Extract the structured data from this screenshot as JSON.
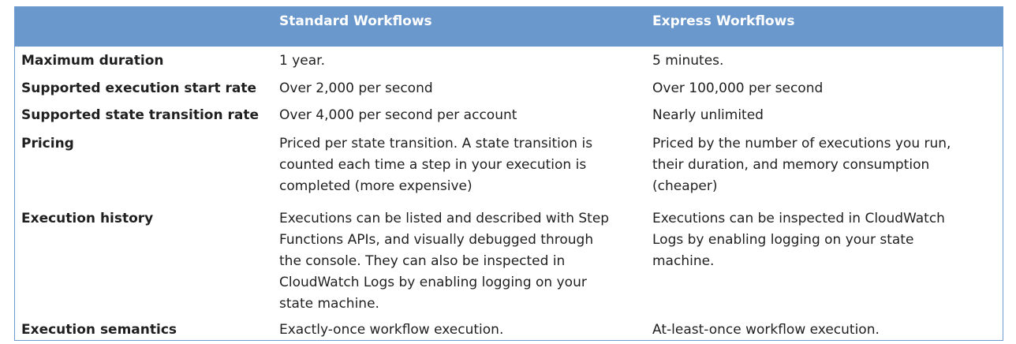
{
  "table": {
    "headers": [
      "",
      "Standard Workflows",
      "Express Workflows"
    ],
    "rows": [
      {
        "label": "Maximum duration",
        "standard": [
          "1 year."
        ],
        "express": [
          "5 minutes."
        ]
      },
      {
        "label": "Supported execution start rate",
        "standard": [
          "Over 2,000 per second"
        ],
        "express": [
          "Over 100,000 per second"
        ]
      },
      {
        "label": "Supported state transition rate",
        "standard": [
          "Over 4,000 per second per account"
        ],
        "express": [
          "Nearly unlimited"
        ]
      },
      {
        "label": "Pricing",
        "standard": [
          "Priced per state transition. A state transition is",
          "counted each time a step in your execution is",
          "completed (more expensive)"
        ],
        "express": [
          "Priced by the number of executions you run,",
          "their duration, and memory consumption",
          "(cheaper)"
        ]
      },
      {
        "label": "Execution history",
        "standard": [
          "Executions can be listed and described with Step",
          "Functions APIs, and visually debugged through",
          "the console. They can also be inspected in",
          "CloudWatch Logs by enabling logging on your",
          "state machine."
        ],
        "express": [
          "Executions can be inspected in CloudWatch",
          "Logs by enabling logging on your state",
          "machine."
        ]
      },
      {
        "label": "Execution semantics",
        "standard": [
          "Exactly-once workflow execution."
        ],
        "express": [
          "At-least-once workflow execution."
        ]
      }
    ]
  },
  "colors": {
    "header_bg": "#6a98cd",
    "border": "#6d9bd0",
    "header_text": "#ffffff",
    "body_text": "#1f1f1f"
  }
}
